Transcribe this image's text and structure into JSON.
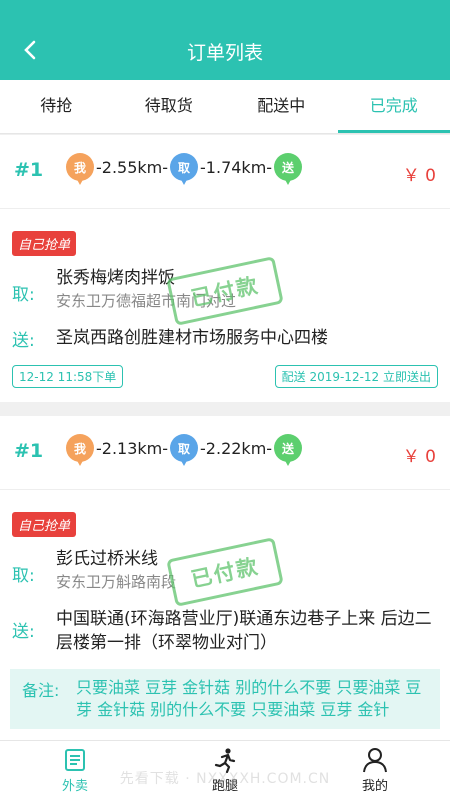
{
  "header": {
    "title": "订单列表"
  },
  "tabs": [
    {
      "label": "待抢"
    },
    {
      "label": "待取货"
    },
    {
      "label": "配送中"
    },
    {
      "label": "已完成"
    }
  ],
  "orders": [
    {
      "num": "#1",
      "pin_me": "我",
      "dist1": "-2.55km-",
      "pin_qu": "取",
      "dist2": "-1.74km-",
      "pin_song": "送",
      "price": "￥ 0",
      "badge": "自己抢单",
      "pickup_label": "取:",
      "pickup_name": "张秀梅烤肉拌饭",
      "pickup_addr": "安东卫万德福超市南门对过",
      "deliver_label": "送:",
      "deliver_addr": "圣岚西路创胜建材市场服务中心四楼",
      "stamp": "已付款",
      "order_time": "12-12 11:58下单",
      "delivery_info": "配送 2019-12-12 立即送出"
    },
    {
      "num": "#1",
      "pin_me": "我",
      "dist1": "-2.13km-",
      "pin_qu": "取",
      "dist2": "-2.22km-",
      "pin_song": "送",
      "price": "￥ 0",
      "badge": "自己抢单",
      "pickup_label": "取:",
      "pickup_name": "彭氏过桥米线",
      "pickup_addr": "安东卫万斛路南段",
      "deliver_label": "送:",
      "deliver_addr": "中国联通(环海路营业厅)联通东边巷子上来 后边二层楼第一排（环翠物业对门）",
      "stamp": "已付款",
      "note_label": "备注:",
      "note_text": "只要油菜 豆芽 金针菇 别的什么不要 只要油菜 豆芽 金针菇 别的什么不要 只要油菜 豆芽 金针"
    }
  ],
  "bottom_nav": [
    {
      "label": "外卖",
      "icon": "takeout-icon"
    },
    {
      "label": "跑腿",
      "icon": "runner-icon"
    },
    {
      "label": "我的",
      "icon": "user-icon"
    }
  ],
  "watermark": "先看下载 · NXXXXH.COM.CN",
  "colors": {
    "accent": "#2cc2b1",
    "price": "#e8413c",
    "stamp": "#5fc36d"
  }
}
